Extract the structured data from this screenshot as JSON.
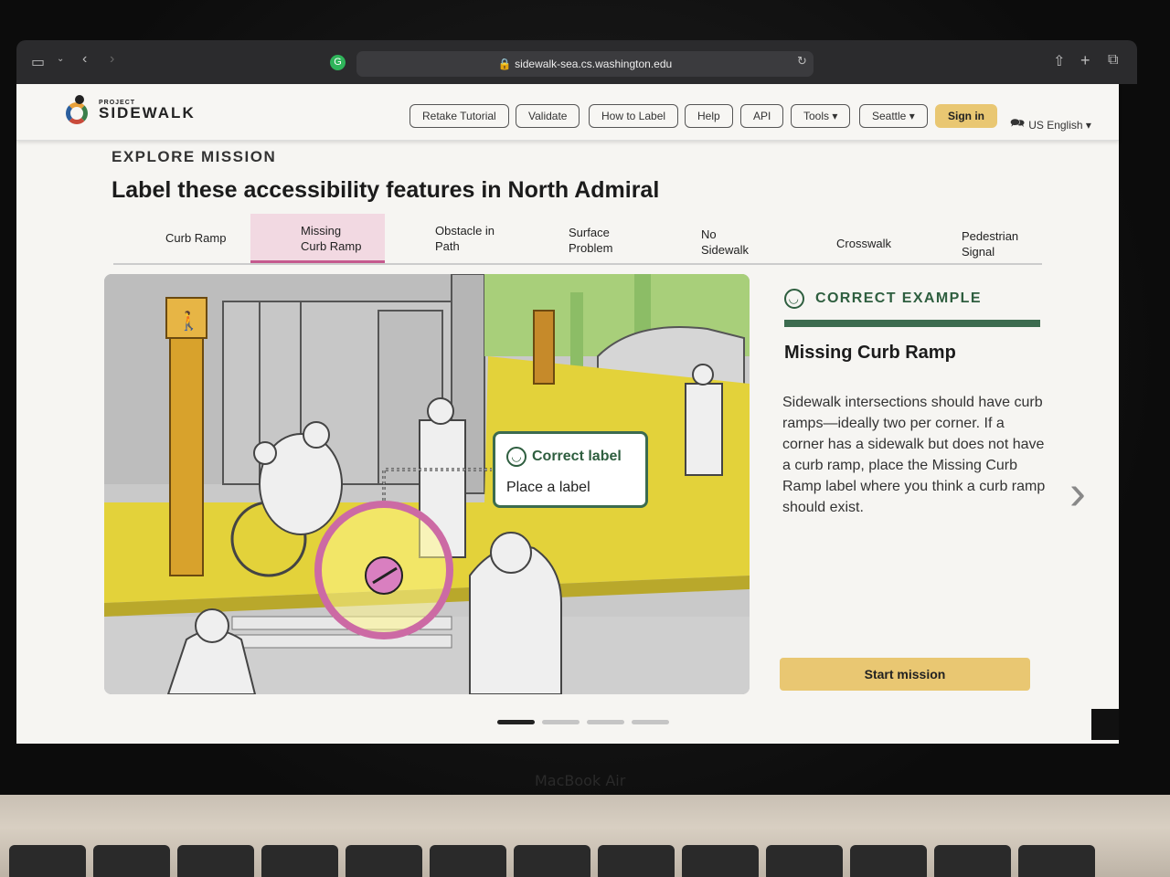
{
  "browser": {
    "url": "sidewalk-sea.cs.washington.edu"
  },
  "logo": {
    "small": "PROJECT",
    "big": "SIDEWALK"
  },
  "nav": {
    "retake": "Retake Tutorial",
    "validate": "Validate",
    "how_to_label": "How to Label",
    "help": "Help",
    "api": "API",
    "tools": "Tools ▾",
    "seattle": "Seattle ▾",
    "signin": "Sign in",
    "language": "US English ▾"
  },
  "mission": {
    "label": "EXPLORE MISSION",
    "title": "Label these accessibility features in North Admiral"
  },
  "tabs": [
    {
      "line1": "Curb Ramp",
      "line2": ""
    },
    {
      "line1": "Missing",
      "line2": "Curb Ramp"
    },
    {
      "line1": "Obstacle in",
      "line2": "Path"
    },
    {
      "line1": "Surface",
      "line2": "Problem"
    },
    {
      "line1": "No",
      "line2": "Sidewalk"
    },
    {
      "line1": "Crosswalk",
      "line2": ""
    },
    {
      "line1": "Pedestrian",
      "line2": "Signal"
    }
  ],
  "callout": {
    "title": "Correct label",
    "sub": "Place a label"
  },
  "panel": {
    "head": "CORRECT EXAMPLE",
    "feature": "Missing Curb Ramp",
    "description": "Sidewalk intersections should have curb ramps—ideally two per corner. If a corner has a sidewalk but does not have a curb ramp, place the Missing Curb Ramp label where you think a curb ramp should exist.",
    "start": "Start mission"
  },
  "device": {
    "label": "MacBook Air"
  },
  "colors": {
    "accent_gold": "#e9c772",
    "accent_green": "#3c6b4f",
    "accent_pink": "#c55a8e"
  }
}
